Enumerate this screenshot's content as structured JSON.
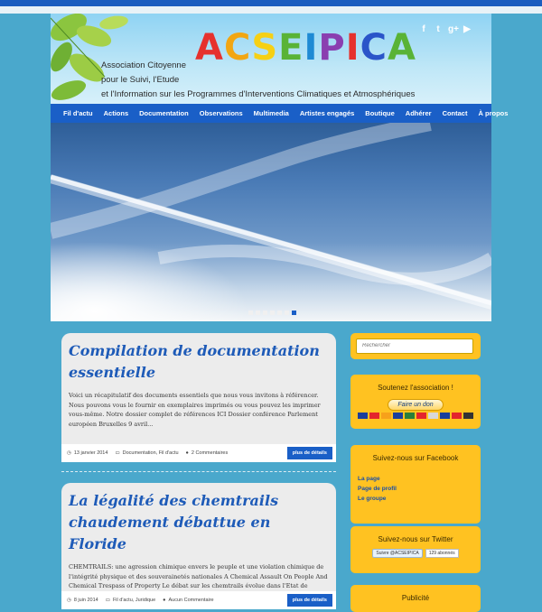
{
  "header": {
    "logo_letters": [
      "A",
      "C",
      "S",
      "E",
      "I",
      "P",
      "I",
      "C",
      "A"
    ],
    "logo_colors": [
      "#e6312d",
      "#f2a612",
      "#f6d014",
      "#59b336",
      "#1f8ad4",
      "#8a3fb0",
      "#e6312d",
      "#2a54c9",
      "#59b336"
    ],
    "assoc_lines": [
      "Association Citoyenne",
      "pour le Suivi, l'Etude",
      "et l'Information sur les Programmes d'Interventions Climatiques et Atmosphériques"
    ],
    "socials": [
      "f",
      "t",
      "g+",
      "▶"
    ]
  },
  "nav": {
    "items": [
      "Fil d'actu",
      "Actions",
      "Documentation",
      "Observations",
      "Multimedia",
      "Artistes engagés",
      "Boutique",
      "Adhérer",
      "Contact",
      "À propos"
    ]
  },
  "slider": {
    "dot_count": 7,
    "active_index": 6
  },
  "posts": [
    {
      "title": "Compilation de documentation essentielle",
      "body": "Voici un récapitulatif des documents essentiels que nous vous invitons à référencer. Nous pouvons vous le fournir en exemplaires imprimés ou vous pouvez les imprimer vous-même. Notre dossier complet de références ICI   Dossier conférence Parlement européen Bruxelles 9 avril...",
      "date": "13 janvier 2014",
      "categories": "Documentation, Fil d'actu",
      "comments": "2 Commentaires",
      "more": "plus de détails"
    },
    {
      "title": "La légalité des chemtrails chaudement débattue en Floride",
      "body": "CHEMTRAILS: une agression chimique envers le peuple et une violation chimique de l'intégrité physique et des souverainetés nationales A Chemical Assault On People And Chemical Trespass of Property Le débat sur les chemtrails évolue dans l'Etat de Floride: la question...",
      "date": "8 juin 2014",
      "categories": "Fil d'actu, Juridique",
      "comments": "Aucun Commentaire",
      "more": "plus de détails"
    }
  ],
  "sidebar": {
    "search_placeholder": "Rechercher",
    "support_title": "Soutenez l'association !",
    "donate_label": "Faire un don",
    "card_colors": [
      "#1a3e9c",
      "#e4252c",
      "#f7a11a",
      "#1a3e9c",
      "#2a7f3a",
      "#e4252c",
      "#d8d8d8",
      "#1a3e9c",
      "#e4252c",
      "#333333"
    ],
    "facebook_title": "Suivez-nous sur Facebook",
    "facebook_links": [
      "La page",
      "Page de profil",
      "Le groupe"
    ],
    "twitter_title": "Suivez-nous sur Twitter",
    "twitter_button": "Suivre @ACSEIPICA",
    "twitter_count": "129 abonnés",
    "pub_title": "Publicité"
  }
}
